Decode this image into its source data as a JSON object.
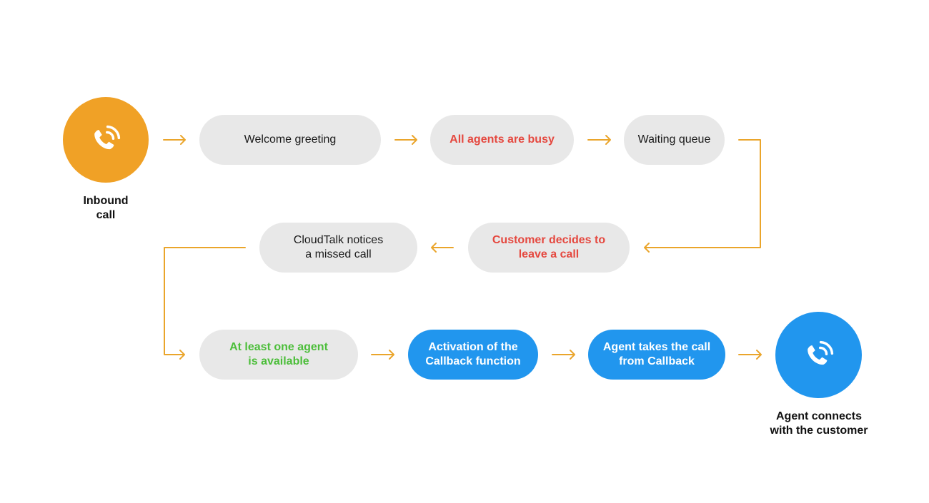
{
  "colors": {
    "connector": "#eaa52b",
    "start_circle": "#f0a126",
    "end_circle": "#2196ee",
    "pill_gray": "#e8e8e8",
    "pill_blue": "#2196ee",
    "text_red": "#e5483f",
    "text_green": "#4cbe3a"
  },
  "start": {
    "icon": "phone-ringing-icon",
    "label": "Inbound\ncall"
  },
  "steps": [
    {
      "id": "welcome",
      "label": "Welcome greeting",
      "style": "gray",
      "text_color": "default"
    },
    {
      "id": "busy",
      "label": "All agents are busy",
      "style": "gray",
      "text_color": "red"
    },
    {
      "id": "queue",
      "label": "Waiting queue",
      "style": "gray",
      "text_color": "default"
    },
    {
      "id": "leave",
      "label": "Customer decides to\nleave a call",
      "style": "gray",
      "text_color": "red"
    },
    {
      "id": "missed",
      "label": "CloudTalk notices\na missed call",
      "style": "gray",
      "text_color": "default"
    },
    {
      "id": "available",
      "label": "At least one agent\nis available",
      "style": "gray",
      "text_color": "green"
    },
    {
      "id": "activation",
      "label": "Activation of the\nCallback function",
      "style": "blue",
      "text_color": "white"
    },
    {
      "id": "takes",
      "label": "Agent takes the call\nfrom Callback",
      "style": "blue",
      "text_color": "white"
    }
  ],
  "end": {
    "icon": "phone-ringing-icon",
    "label": "Agent connects\nwith the customer"
  },
  "flow": [
    "start",
    "welcome",
    "busy",
    "queue",
    "leave",
    "missed",
    "available",
    "activation",
    "takes",
    "end"
  ]
}
